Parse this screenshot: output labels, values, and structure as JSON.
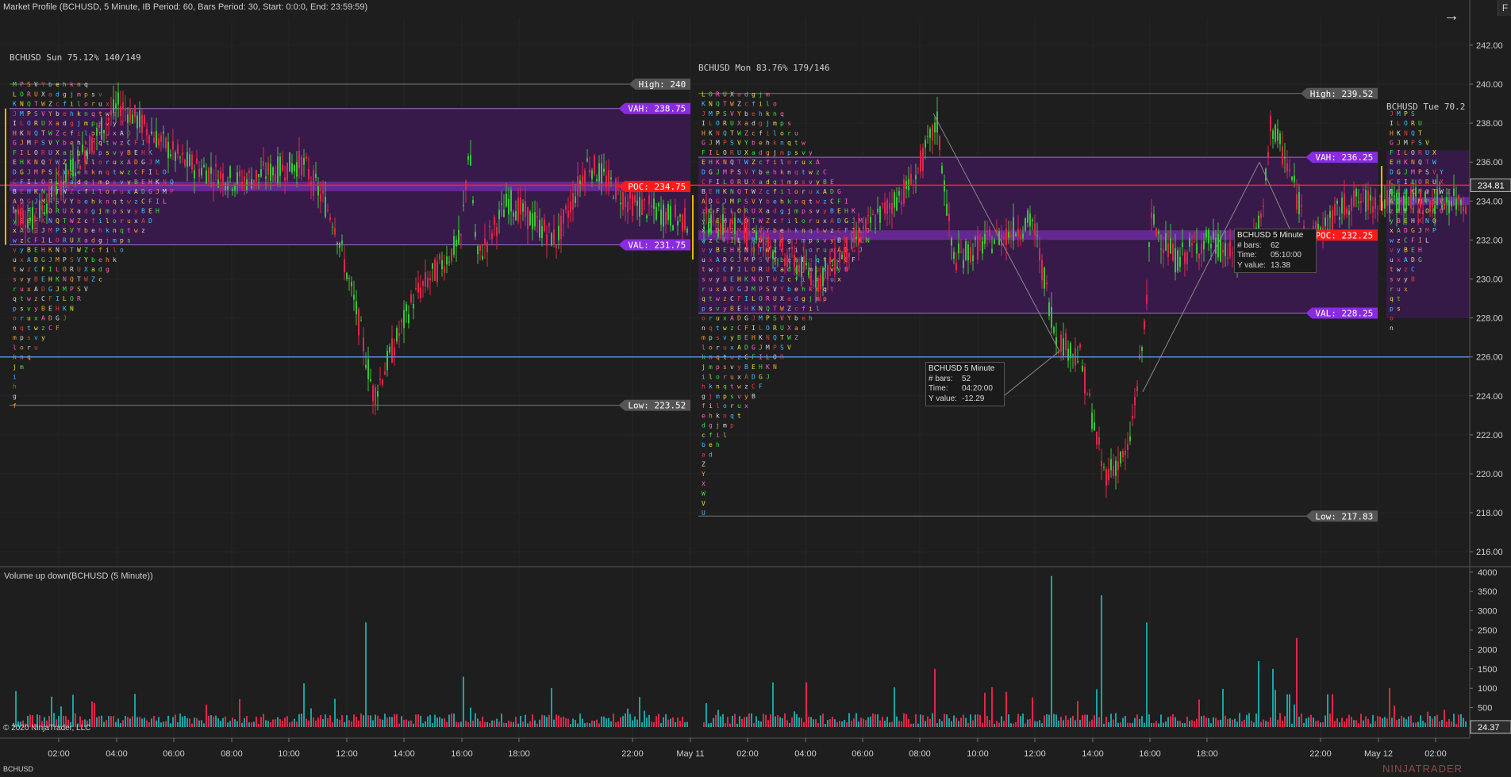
{
  "window": {
    "title": "Market Profile (BCHUSD, 5 Minute, IB Period: 60, Bars Period: 30, Start: 0:0:0, End: 23:59:59)",
    "instrument_label": "BCHUSD",
    "copyright": "© 2020 NinjaTrader, LLC",
    "brand": "NINJATRADER"
  },
  "toolbar": {
    "arrow_icon": "arrow-right-icon",
    "f_label": "F"
  },
  "profiles": [
    {
      "header": "BCHUSD  Sun  75.12%  140/149",
      "high_label": "High: 240",
      "high_value": 240,
      "vah_label": "VAH: 238.75",
      "vah_value": 238.75,
      "poc_label": "POC: 234.75",
      "poc_value": 234.75,
      "val_label": "VAL: 231.75",
      "val_value": 231.75,
      "low_label": "Low: 223.52",
      "low_value": 223.52
    },
    {
      "header": "BCHUSD  Mon  83.76%  179/146",
      "high_label": "High: 239.52",
      "high_value": 239.52,
      "vah_label": "VAH: 236.25",
      "vah_value": 236.25,
      "poc_label": "POC: 232.25",
      "poc_value": 232.25,
      "val_label": "VAL: 228.25",
      "val_value": 228.25,
      "low_label": "Low: 217.83",
      "low_value": 217.83
    },
    {
      "header": "BCHUSD  Tue  70.2"
    }
  ],
  "price_axis": {
    "ticks": [
      "242.00",
      "240.00",
      "238.00",
      "236.00",
      "234.00",
      "232.00",
      "230.00",
      "228.00",
      "226.00",
      "224.00",
      "222.00",
      "220.00",
      "218.00",
      "216.00"
    ],
    "tick_values": [
      242,
      240,
      238,
      236,
      234,
      232,
      230,
      228,
      226,
      224,
      222,
      220,
      218,
      216
    ],
    "last_price_label": "234.81",
    "last_price": 234.81,
    "horizontal_line": 226.0
  },
  "volume_panel": {
    "title": "Volume up down(BCHUSD (5 Minute))",
    "ticks": [
      "4000",
      "3500",
      "3000",
      "2500",
      "2000",
      "1500",
      "1000",
      "500"
    ],
    "tick_values": [
      4000,
      3500,
      3000,
      2500,
      2000,
      1500,
      1000,
      500
    ],
    "last_label": "24.37"
  },
  "time_axis": {
    "labels": [
      "02:00",
      "04:00",
      "06:00",
      "08:00",
      "10:00",
      "12:00",
      "14:00",
      "16:00",
      "18:00",
      "22:00",
      "May 11",
      "02:00",
      "04:00",
      "06:00",
      "08:00",
      "10:00",
      "12:00",
      "14:00",
      "16:00",
      "18:00",
      "22:00",
      "May 12",
      "02:00"
    ]
  },
  "tooltips": [
    {
      "title": "BCHUSD 5 Minute",
      "bars_key": "# bars:",
      "bars": "62",
      "time_key": "Time:",
      "time": "05:10:00",
      "y_key": "Y value:",
      "y": "13.38"
    },
    {
      "title": "BCHUSD 5 Minute",
      "bars_key": "# bars:",
      "bars": "52",
      "time_key": "Time:",
      "time": "04:20:00",
      "y_key": "Y value:",
      "y": "-12.29"
    }
  ],
  "colors": {
    "background": "#1e1e1e",
    "value_area": "#3a1a4f",
    "poc_band": "#6a2a9a",
    "vah_val_tag": "#8a2be2",
    "poc_tag": "#ff1a1a",
    "up_candle": "#39c43a",
    "down_candle": "#e0264a",
    "vol_up": "#1aa3a3",
    "vol_down": "#e0264a",
    "hline": "#5b8fd9"
  }
}
